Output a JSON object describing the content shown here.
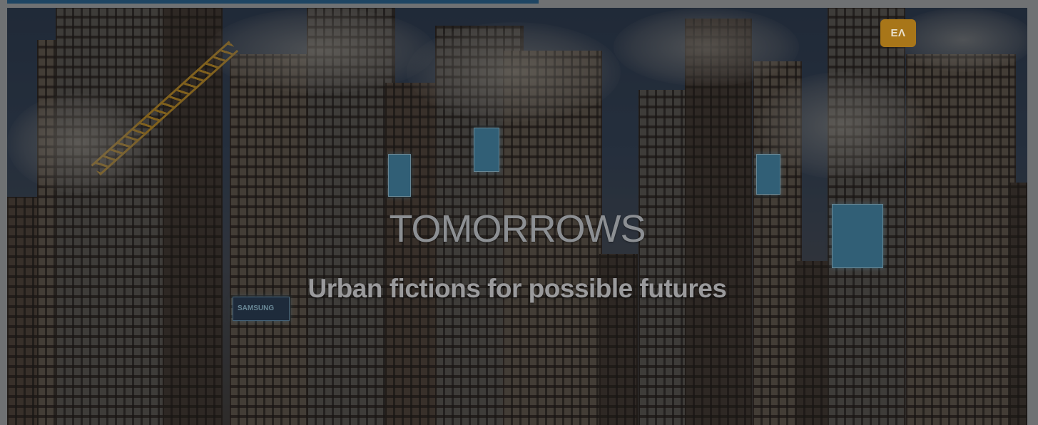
{
  "hero": {
    "title": "TOMORROWS",
    "subtitle": "Urban fictions for possible futures",
    "language_badge": "EΛ"
  },
  "billboards": {
    "brand": "SAMSUNG"
  },
  "colors": {
    "top_strip": "#1e4563",
    "badge": "#a87619",
    "overlay": "rgba(30,30,32,0.42)"
  }
}
